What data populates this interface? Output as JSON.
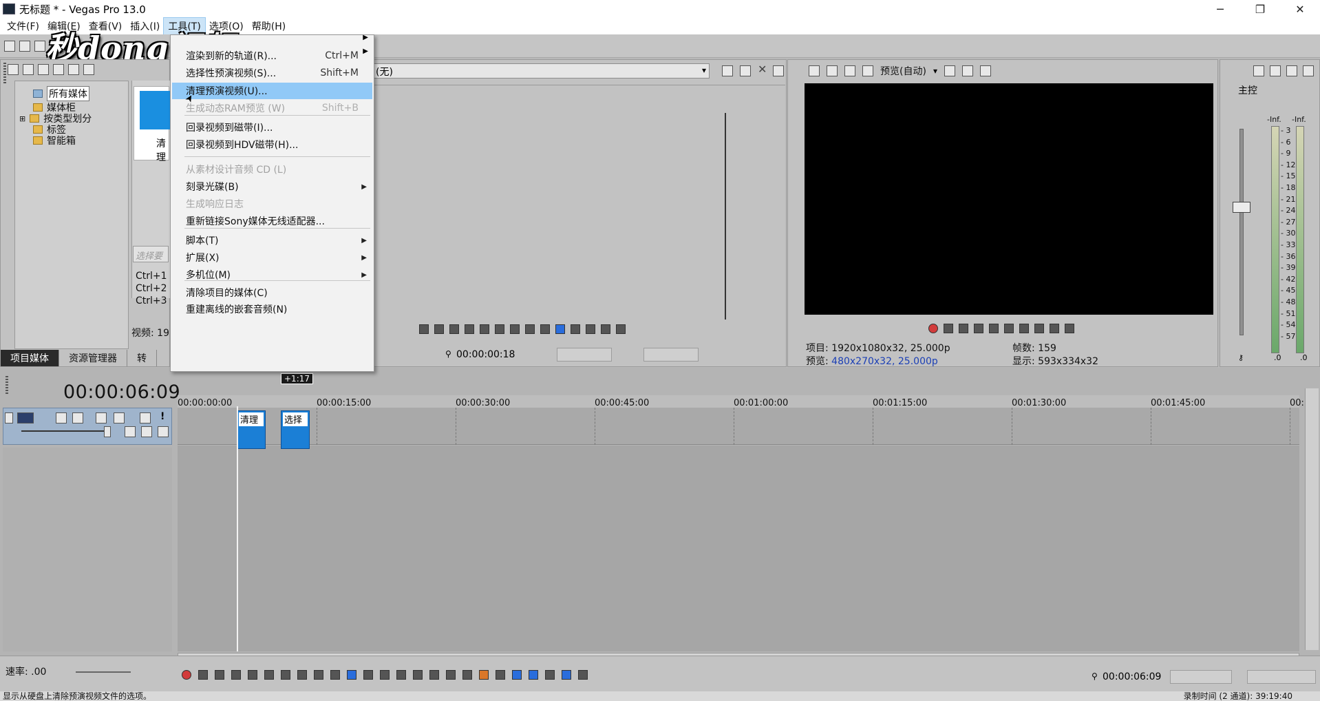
{
  "window": {
    "title": "无标题 * - Vegas Pro 13.0",
    "controls": [
      "─",
      "❐",
      "✕"
    ]
  },
  "menubar": {
    "items": [
      "文件(F)",
      "编辑(E)",
      "查看(V)",
      "插入(I)",
      "工具(T)",
      "选项(O)",
      "帮助(H)"
    ],
    "active_index": 4
  },
  "watermark": "秒dong视频",
  "tools_menu": {
    "items": [
      {
        "label": "渲染到新的轨道(R)...",
        "shortcut": "Ctrl+M",
        "enabled": true
      },
      {
        "label": "选择性预演视频(S)...",
        "shortcut": "Shift+M",
        "enabled": true
      },
      {
        "label": "清理预演视频(U)...",
        "shortcut": "",
        "enabled": true,
        "highlighted": true
      },
      {
        "label": "生成动态RAM预览 (W)",
        "shortcut": "Shift+B",
        "enabled": false
      },
      {
        "label": "回录视频到磁带(I)...",
        "shortcut": "",
        "enabled": true
      },
      {
        "label": "回录视频到HDV磁带(H)...",
        "shortcut": "",
        "enabled": true
      },
      {
        "label": "从素材设计音频 CD (L)",
        "shortcut": "",
        "enabled": false
      },
      {
        "label": "刻录光碟(B)",
        "shortcut": "",
        "enabled": true,
        "submenu": true
      },
      {
        "label": "生成响应日志",
        "shortcut": "",
        "enabled": false
      },
      {
        "label": "重新链接Sony媒体无线适配器...",
        "shortcut": "",
        "enabled": true
      },
      {
        "label": "脚本(T)",
        "shortcut": "",
        "enabled": true,
        "submenu": true
      },
      {
        "label": "扩展(X)",
        "shortcut": "",
        "enabled": true,
        "submenu": true
      },
      {
        "label": "多机位(M)",
        "shortcut": "",
        "enabled": true,
        "submenu": true
      },
      {
        "label": "清除项目的媒体(C)",
        "shortcut": "",
        "enabled": true
      },
      {
        "label": "重建离线的嵌套音频(N)",
        "shortcut": "",
        "enabled": true
      }
    ]
  },
  "media_panel": {
    "tree": [
      {
        "label": "所有媒体",
        "selected": true
      },
      {
        "label": "媒体柜",
        "selected": false
      },
      {
        "label": "按类型划分",
        "selected": false
      },
      {
        "label": "标签",
        "selected": false
      },
      {
        "label": "智能箱",
        "selected": false
      }
    ],
    "thumb_label": "清理",
    "search_placeholder": "选择要",
    "shortcuts": [
      "Ctrl+1",
      "Ctrl+2",
      "Ctrl+3"
    ],
    "video_count": "视频: 19",
    "tabs": [
      "项目媒体",
      "资源管理器",
      "转"
    ]
  },
  "trimmer": {
    "selection": "(无)",
    "time": "00:00:00:18"
  },
  "preview": {
    "mode": "预览(自动)",
    "project_label": "项目:",
    "project_value": "1920x1080x32, 25.000p",
    "preview_label": "预览:",
    "preview_value": "480x270x32, 25.000p",
    "frames_label": "帧数:",
    "frames_value": "159",
    "display_label": "显示:",
    "display_value": "593x334x32"
  },
  "master": {
    "title": "主控",
    "inf_left": "-Inf.",
    "inf_right": "-Inf.",
    "scale": [
      "3",
      "6",
      "9",
      "12",
      "15",
      "18",
      "21",
      "24",
      "27",
      "30",
      "33",
      "36",
      "39",
      "42",
      "45",
      "48",
      "51",
      "54",
      "57"
    ],
    "bottom_left": ".0",
    "bottom_right": ".0"
  },
  "timeline": {
    "current_time": "00:00:06:09",
    "playhead_tag": "+1:17",
    "ruler": [
      "00:00:00:00",
      "00:00:15:00",
      "00:00:30:00",
      "00:00:45:00",
      "00:01:00:00",
      "00:01:15:00",
      "00:01:30:00",
      "00:01:45:00",
      "00:"
    ],
    "clips": [
      "清理",
      "选择"
    ]
  },
  "bottom": {
    "rate": "速率: .00",
    "time": "00:00:06:09"
  },
  "status": {
    "text": "显示从硬盘上清除预演视频文件的选项。",
    "right": "录制时间 (2 通道): 39:19:40"
  }
}
